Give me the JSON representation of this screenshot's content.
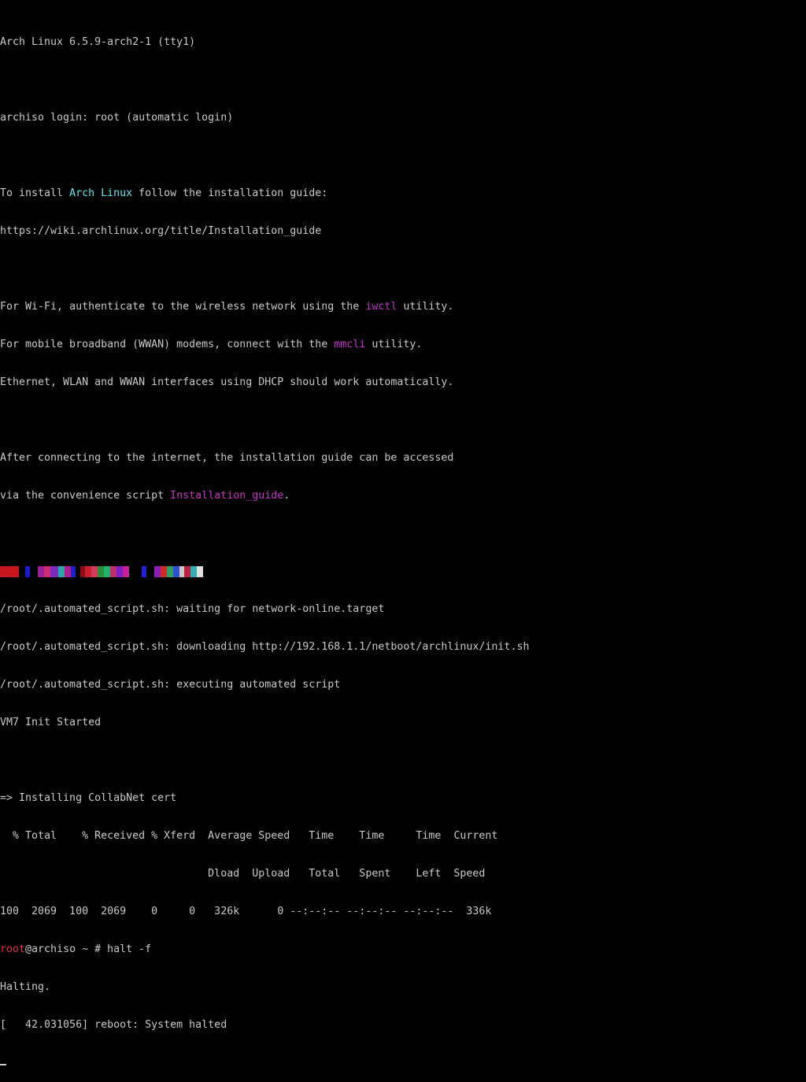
{
  "terminal": {
    "lines": {
      "l1": "Arch Linux 6.5.9-arch2-1 (tty1)",
      "l2": "archiso login: root (automatic login)",
      "l3a": "To install ",
      "l3b": "Arch Linux",
      "l3c": " follow the installation guide:",
      "l4": "https://wiki.archlinux.org/title/Installation_guide",
      "l5a": "For Wi-Fi, authenticate to the wireless network using the ",
      "l5b": "iwctl",
      "l5c": " utility.",
      "l6a": "For mobile broadband (WWAN) modems, connect with the ",
      "l6b": "mmcli",
      "l6c": " utility.",
      "l7": "Ethernet, WLAN and WWAN interfaces using DHCP should work automatically.",
      "l8": "After connecting to the internet, the installation guide can be accessed",
      "l9a": "via the convenience script ",
      "l9b": "Installation_guide",
      "l9c": ".",
      "l10": "/root/.automated_script.sh: waiting for network-online.target",
      "l11": "/root/.automated_script.sh: downloading http://192.168.1.1/netboot/archlinux/init.sh",
      "l12": "/root/.automated_script.sh: executing automated script",
      "l13": "VM7 Init Started",
      "l14": "=> Installing CollabNet cert",
      "l15": "  % Total    % Received % Xferd  Average Speed   Time    Time     Time  Current",
      "l16": "                                 Dload  Upload   Total   Spent    Left  Speed",
      "l17": "100  2069  100  2069    0     0   326k      0 --:--:-- --:--:-- --:--:--  336k",
      "l18a": "root",
      "l18b": "@archiso ~ # halt -f",
      "l19": "Halting.",
      "l20": "[   42.031056] reboot: System halted"
    },
    "colors": {
      "text": "#c8c8c8",
      "cyan": "#5fe8f0",
      "magenta": "#c435c4",
      "red": "#e8324a",
      "background": "#000000"
    }
  }
}
